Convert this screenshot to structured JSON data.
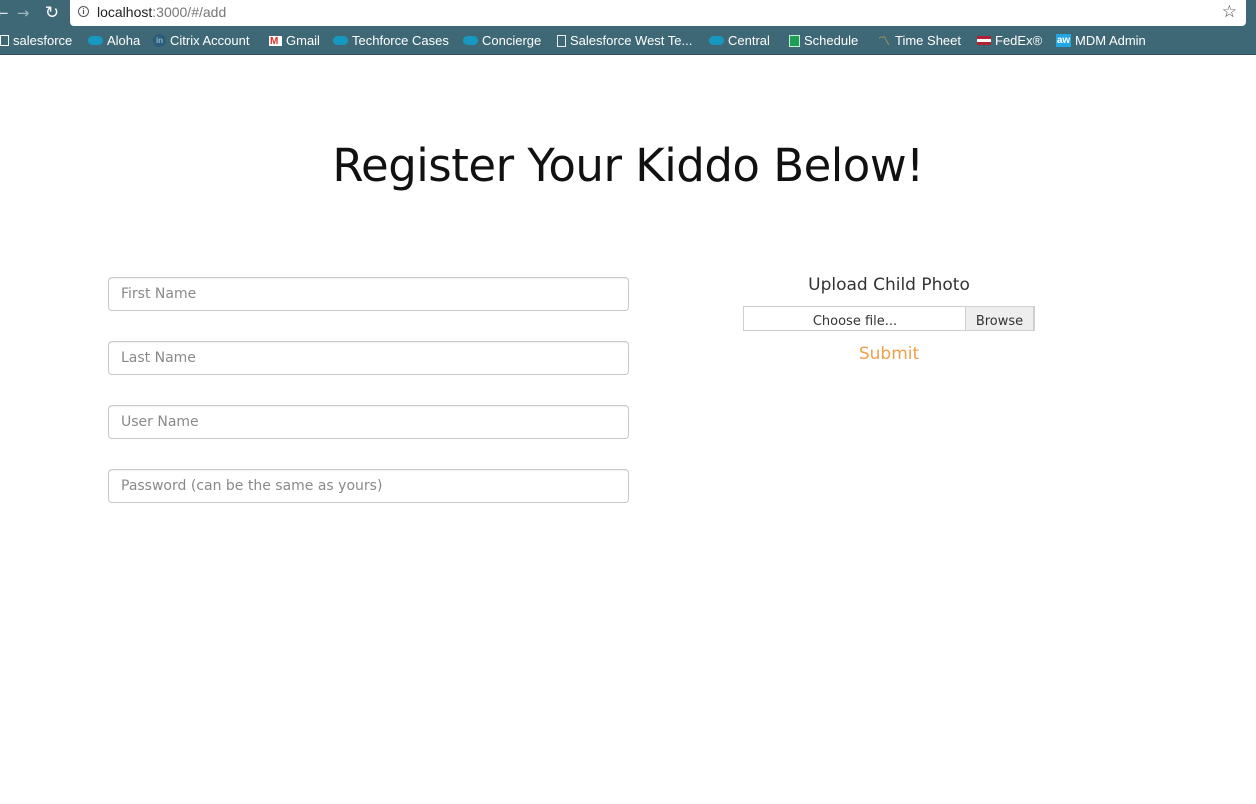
{
  "browser": {
    "url_host": "localhost",
    "url_rest": ":3000/#/add",
    "bookmarks": [
      {
        "label": "salesforce",
        "icon": "doc-icon"
      },
      {
        "label": "Aloha",
        "icon": "cloud-icon"
      },
      {
        "label": "Citrix Account",
        "icon": "linkedin-icon"
      },
      {
        "label": "Gmail",
        "icon": "gmail-icon"
      },
      {
        "label": "Techforce Cases",
        "icon": "cloud-icon"
      },
      {
        "label": "Concierge",
        "icon": "cloud-icon"
      },
      {
        "label": "Salesforce West Te...",
        "icon": "page-icon"
      },
      {
        "label": "Central",
        "icon": "cloud-icon"
      },
      {
        "label": "Schedule",
        "icon": "sheet-icon"
      },
      {
        "label": "Time Sheet",
        "icon": "clock-icon"
      },
      {
        "label": "FedEx®",
        "icon": "flag-icon"
      },
      {
        "label": "MDM Admin",
        "icon": "aw-icon",
        "icon_text": "aw"
      }
    ]
  },
  "page": {
    "title": "Register Your Kiddo Below!",
    "form": {
      "first_name_placeholder": "First Name",
      "last_name_placeholder": "Last Name",
      "user_name_placeholder": "User Name",
      "password_placeholder": "Password (can be the same as yours)"
    },
    "upload": {
      "label": "Upload Child Photo",
      "file_text": "Choose file...",
      "browse_label": "Browse"
    },
    "submit_label": "Submit"
  },
  "colors": {
    "chrome": "#3f6876",
    "submit": "#f0a04b"
  }
}
